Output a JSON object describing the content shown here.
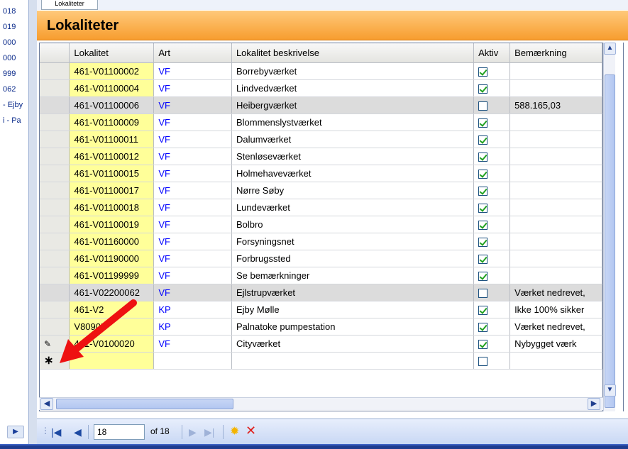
{
  "left_strip": {
    "items": [
      "018",
      "019",
      "000",
      "000",
      "999",
      "062",
      "- Ejby",
      "i - Pa"
    ]
  },
  "tab": {
    "label": "Lokaliteter"
  },
  "panel": {
    "title": "Lokaliteter"
  },
  "grid": {
    "columns": [
      "Lokalitet",
      "Art",
      "Lokalitet beskrivelse",
      "Aktiv",
      "Bemærkning"
    ],
    "rows": [
      {
        "lok": "461-V01100002",
        "art": "VF",
        "desc": "Borrebyværket",
        "aktiv": true,
        "note": "",
        "state": ""
      },
      {
        "lok": "461-V01100004",
        "art": "VF",
        "desc": "Lindvedværket",
        "aktiv": true,
        "note": "",
        "state": ""
      },
      {
        "lok": "461-V01100006",
        "art": "VF",
        "desc": "Heibergværket",
        "aktiv": false,
        "note": "588.165,03",
        "state": "grey"
      },
      {
        "lok": "461-V01100009",
        "art": "VF",
        "desc": "Blommenslystværket",
        "aktiv": true,
        "note": "",
        "state": ""
      },
      {
        "lok": "461-V01100011",
        "art": "VF",
        "desc": "Dalumværket",
        "aktiv": true,
        "note": "",
        "state": ""
      },
      {
        "lok": "461-V01100012",
        "art": "VF",
        "desc": "Stenløseværket",
        "aktiv": true,
        "note": "",
        "state": ""
      },
      {
        "lok": "461-V01100015",
        "art": "VF",
        "desc": "Holmehaveværket",
        "aktiv": true,
        "note": "",
        "state": ""
      },
      {
        "lok": "461-V01100017",
        "art": "VF",
        "desc": "Nørre Søby",
        "aktiv": true,
        "note": "",
        "state": ""
      },
      {
        "lok": "461-V01100018",
        "art": "VF",
        "desc": "Lundeværket",
        "aktiv": true,
        "note": "",
        "state": ""
      },
      {
        "lok": "461-V01100019",
        "art": "VF",
        "desc": "Bolbro",
        "aktiv": true,
        "note": "",
        "state": ""
      },
      {
        "lok": "461-V01160000",
        "art": "VF",
        "desc": "Forsyningsnet",
        "aktiv": true,
        "note": "",
        "state": ""
      },
      {
        "lok": "461-V01190000",
        "art": "VF",
        "desc": "Forbrugssted",
        "aktiv": true,
        "note": "",
        "state": ""
      },
      {
        "lok": "461-V01199999",
        "art": "VF",
        "desc": "Se bemærkninger",
        "aktiv": true,
        "note": "",
        "state": ""
      },
      {
        "lok": "461-V02200062",
        "art": "VF",
        "desc": "Ejlstrupværket",
        "aktiv": false,
        "note": "Værket nedrevet,",
        "state": "grey"
      },
      {
        "lok": "461-V2",
        "art": "KP",
        "desc": "Ejby Mølle",
        "aktiv": true,
        "note": "Ikke 100% sikker",
        "state": ""
      },
      {
        "lok": "V80905",
        "art": "KP",
        "desc": "Palnatoke pumpestation",
        "aktiv": true,
        "note": "Værket nedrevet,",
        "state": ""
      },
      {
        "lok": "461-V0100020",
        "art": "VF",
        "desc": "Cityværket",
        "aktiv": true,
        "note": "Nybygget værk",
        "state": "edit"
      }
    ]
  },
  "navigator": {
    "position": "18",
    "of_label": "of 18"
  },
  "colors": {
    "header_orange": "#f79d2f",
    "lokalitet_yellow": "#ffff99",
    "art_blue": "#0000ff",
    "selected_grey": "#dcdcdc",
    "arrow_red": "#ee1111"
  }
}
